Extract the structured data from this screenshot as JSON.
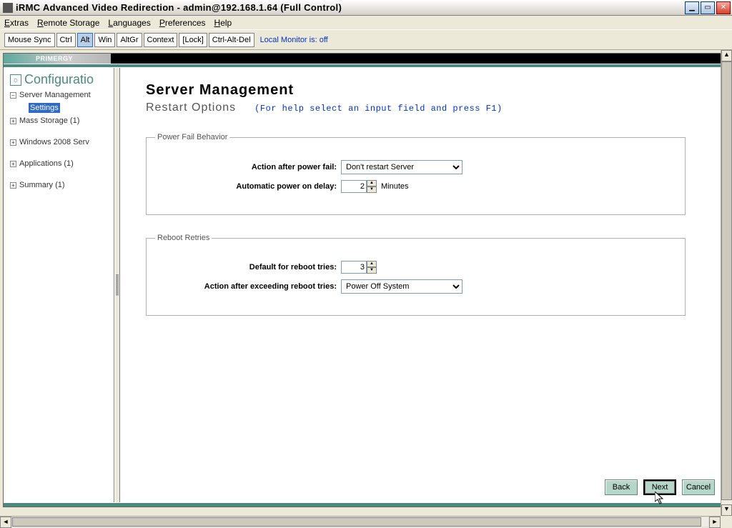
{
  "window": {
    "title": "iRMC Advanced Video Redirection - admin@192.168.1.64 (Full Control)"
  },
  "menu": {
    "extras": "Extras",
    "remote_storage": "Remote Storage",
    "languages": "Languages",
    "preferences": "Preferences",
    "help": "Help"
  },
  "toolbar": {
    "mouse_sync": "Mouse Sync",
    "ctrl": "Ctrl",
    "alt": "Alt",
    "win": "Win",
    "altgr": "AltGr",
    "context": "Context",
    "lock": "[Lock]",
    "cad": "Ctrl-Alt-Del",
    "local_monitor": "Local Monitor is: off"
  },
  "primergy": "PRIMERGY",
  "sidebar": {
    "title": "Configuratio",
    "items": [
      {
        "label": "Server Management",
        "box": "−"
      },
      {
        "label": "Settings",
        "selected": true
      },
      {
        "label": "Mass Storage (1)",
        "box": "+"
      },
      {
        "label": "Windows 2008 Serv",
        "box": "+"
      },
      {
        "label": "Applications (1)",
        "box": "+"
      },
      {
        "label": "Summary (1)",
        "box": "+"
      }
    ]
  },
  "main": {
    "heading": "Server Management",
    "subheading": "Restart Options",
    "help": "(For help select an input field and press F1)",
    "fieldset1": {
      "legend": "Power Fail Behavior",
      "row1_label": "Action after power fail:",
      "row1_value": "Don't restart Server",
      "row2_label": "Automatic power on delay:",
      "row2_value": "2",
      "row2_unit": "Minutes"
    },
    "fieldset2": {
      "legend": "Reboot Retries",
      "row1_label": "Default for reboot tries:",
      "row1_value": "3",
      "row2_label": "Action after exceeding reboot tries:",
      "row2_value": "Power Off System"
    }
  },
  "buttons": {
    "back": "Back",
    "next": "Next",
    "cancel": "Cancel"
  }
}
